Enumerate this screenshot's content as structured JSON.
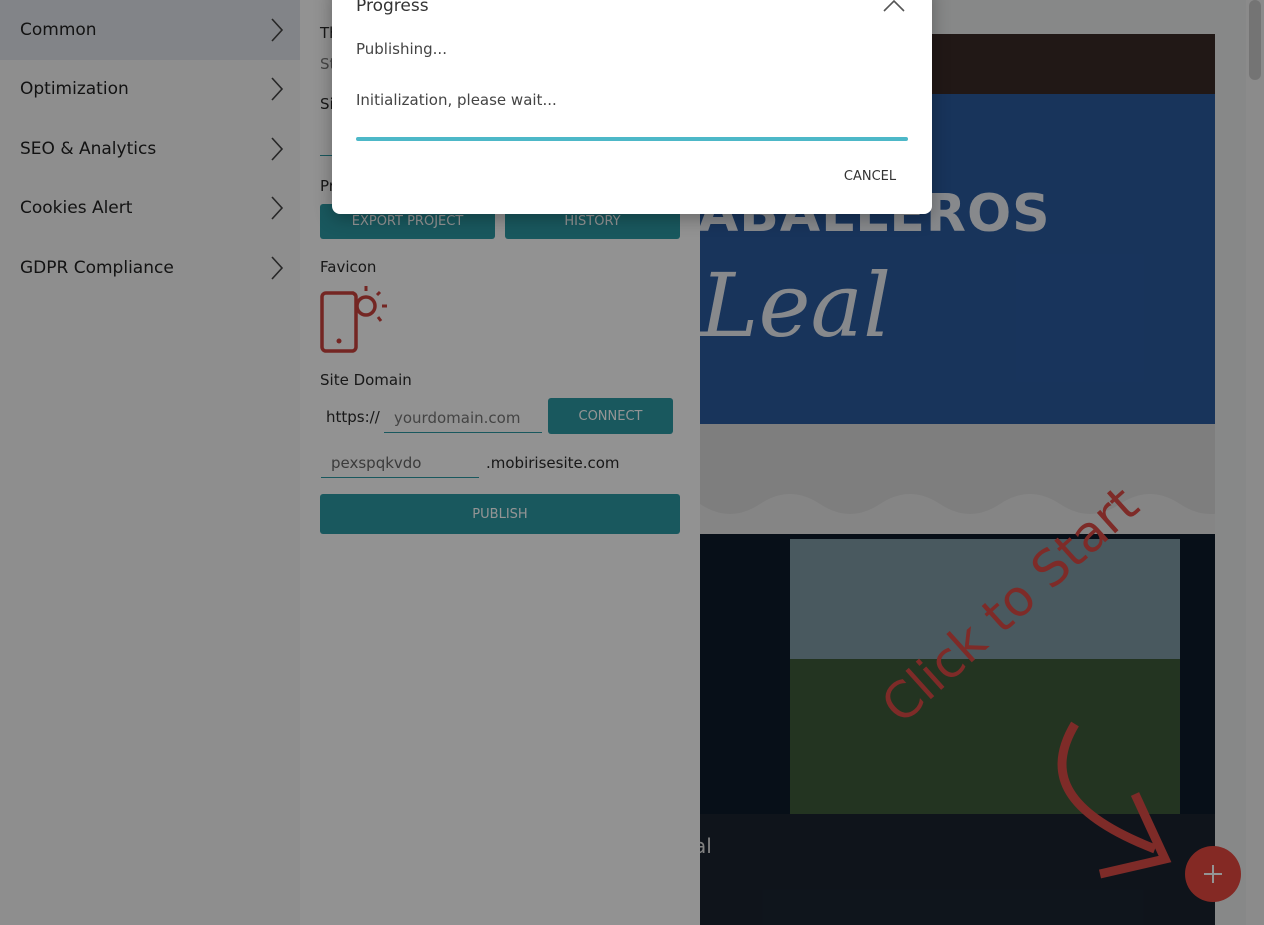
{
  "sidebar": {
    "items": [
      {
        "label": "Common"
      },
      {
        "label": "Optimization"
      },
      {
        "label": "SEO & Analytics"
      },
      {
        "label": "Cookies Alert"
      },
      {
        "label": "GDPR Compliance"
      }
    ]
  },
  "panel": {
    "partial_labels": {
      "theme": "Th",
      "theme_sub": "St",
      "site": "Si",
      "project": "Pr"
    },
    "export_button": "EXPORT PROJECT",
    "history_button": "HISTORY",
    "favicon_label": "Favicon",
    "site_domain_label": "Site Domain",
    "protocol_prefix": "https://",
    "domain_placeholder": "yourdomain.com",
    "connect_button": "CONNECT",
    "subdomain_value": "pexspqkvdo",
    "subdomain_suffix": ".mobirisesite.com",
    "publish_button": "PUBLISH"
  },
  "preview": {
    "sign_text": "ABALLEROS",
    "script_text": "Leal",
    "footer_fragment": "al",
    "overlay_text": "Click to Start"
  },
  "modal": {
    "title": "Progress",
    "status_line_1": "Publishing...",
    "status_line_2": "Initialization, please wait...",
    "progress": 1.0,
    "cancel_button": "CANCEL"
  },
  "colors": {
    "accent": "#2c98a3",
    "fab": "#e3473f",
    "favicon": "#c9433d"
  },
  "icons": [
    "chevron-right-icon",
    "favicon-phone-sun-icon",
    "chevron-up-icon",
    "plus-icon",
    "arrow-icon"
  ]
}
